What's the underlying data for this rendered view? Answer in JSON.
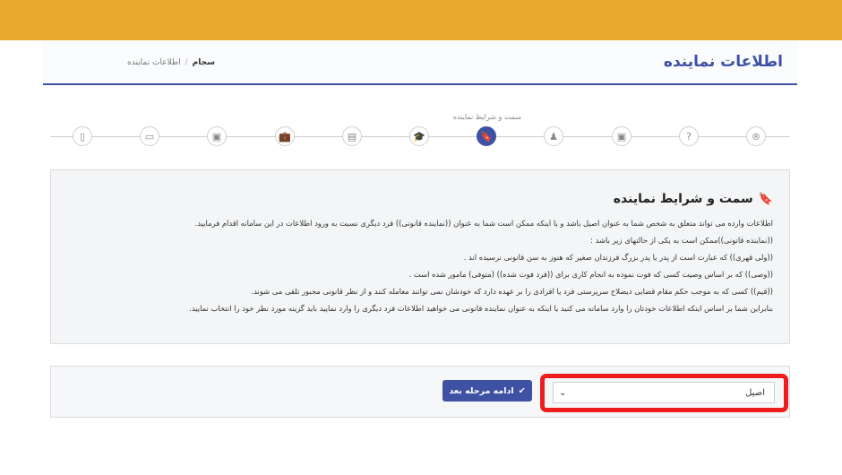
{
  "header": {
    "title": "اطلاعات نماینده",
    "breadcrumb": [
      "سجام",
      "اطلاعات نماینده"
    ],
    "breadcrumb_sep": "/"
  },
  "stepper": {
    "active_caption": "سمت و شرایط نماینده",
    "steps": [
      {
        "icon": "registered-icon",
        "glyph": "®"
      },
      {
        "icon": "question-icon",
        "glyph": "?"
      },
      {
        "icon": "money-icon",
        "glyph": "▣"
      },
      {
        "icon": "person-icon",
        "glyph": "♟"
      },
      {
        "icon": "bookmark-icon",
        "glyph": "🔖",
        "active": true
      },
      {
        "icon": "graduation-cap-icon",
        "glyph": "🎓"
      },
      {
        "icon": "document-icon",
        "glyph": "▤"
      },
      {
        "icon": "briefcase-icon",
        "glyph": "💼"
      },
      {
        "icon": "money-icon",
        "glyph": "▣"
      },
      {
        "icon": "credit-card-icon",
        "glyph": "▭"
      },
      {
        "icon": "id-card-icon",
        "glyph": "▯"
      }
    ]
  },
  "info": {
    "title": "سمت و شرایط نماینده",
    "lines": [
      "اطلاعات وارده می تواند متعلق به شخص شما به عنوان اصیل باشد و یا اینکه ممکن است شما به عنوان ((نماینده قانونی)) فرد دیگری نسبت به ورود اطلاعات در این سامانه اقدام فرمایید.",
      "((نماینده قانونی))ممکن است به یکی از حالتهای زیر باشد :",
      "((ولی قهری)) که عبارت است از پدر یا پدر بزرگ فرزندان صغیر که هنوز به سن قانونی نرسیده اند .",
      "((وصی)) که بر اساس وصیت کسی که فوت نموده به انجام کاری برای ((فرد فوت شده)) (متوفی) مامور شده است .",
      "((قیم)) کسی که به موجب حکم مقام قضایی ذیصلاح سرپرستی فرد یا افرادی را بر عهده دارد که خودشان نمی توانند معامله کنند و از نظر قانونی مجبور تلقی می شوند.",
      "بنابراین شما بر اساس اینکه اطلاعات خودتان را وارد سامانه می کنید یا اینکه به عنوان نماینده قانونی می خواهید اطلاعات فرد دیگری را وارد نمایید باید گزینه مورد نظر خود را انتخاب نمایید."
    ]
  },
  "form": {
    "select_value": "اصیل",
    "next_label": "ادامه مرحله بعد",
    "highlight_color": "#ee1c1c"
  },
  "colors": {
    "topbar": "#e8a92e",
    "accent": "#3f51a3"
  }
}
